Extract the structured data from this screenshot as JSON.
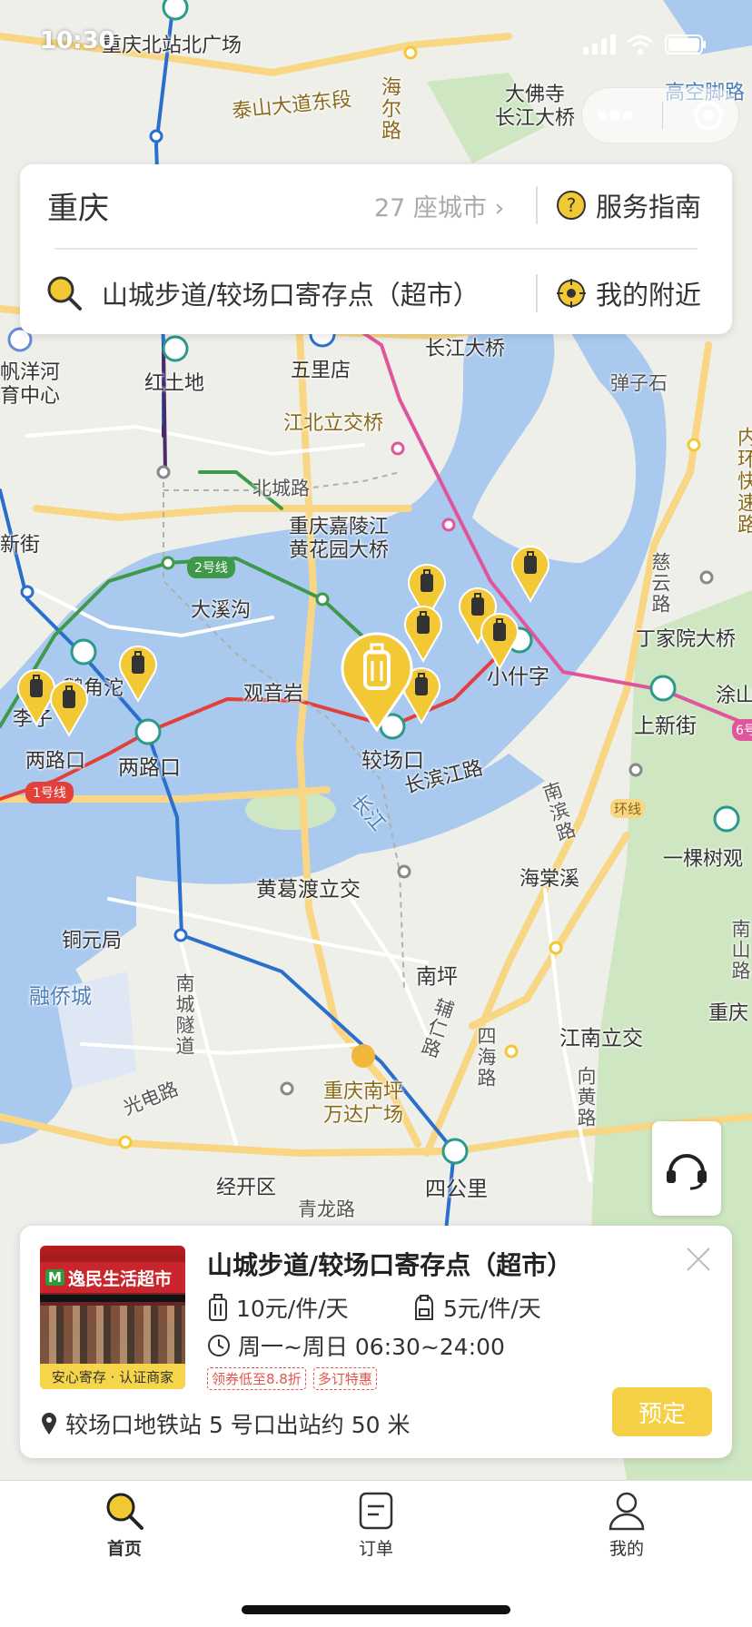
{
  "status_bar": {
    "time": "10:30"
  },
  "search": {
    "city": "重庆",
    "city_count": "27 座城市",
    "guide_label": "服务指南",
    "query": "山城步道/较场口寄存点（超市）",
    "nearby_label": "我的附近"
  },
  "map": {
    "labels": {
      "chongqing_north_square": "重庆北站北广场",
      "taishan_road": "泰山大道东段",
      "dafosi_bridge": "大佛寺\n长江大桥",
      "gaokong": "高空脚路",
      "hailu": "海尔路",
      "hongtudi": "红土地",
      "wulidian": "五里店",
      "changjiang_bridge": "长江大桥",
      "danzishi": "弹子石",
      "jiangbei_interchange": "江北立交桥",
      "fanyanghe": "帆洋河\n育中心",
      "beicheng_road": "北城路",
      "jialing_bridge": "重庆嘉陵江\n黄花园大桥",
      "daxigou": "大溪沟",
      "guanyinyan": "观音岩",
      "jiaochangkou": "较场口",
      "xiaoshizi": "小什字",
      "shangxinjie": "上新街",
      "dingjiayuan_bridge": "丁家院大桥",
      "cilu": "慈云路",
      "neihuan_exp": "内环快速路",
      "liangrukou_1": "两路口",
      "liangrukou_2": "两路口",
      "changbin_road": "长滨江路",
      "yangtze": "长江",
      "nanbin_road": "南滨路",
      "huangge_interchange": "黄葛渡立交",
      "haitangxi": "海棠溪",
      "yikeshu": "一棵树观",
      "tongyuanju": "铜元局",
      "rongqiao": "融侨城",
      "nanping": "南坪",
      "nancheng_tunnel": "南城隧道",
      "fuer_road": "辅仁路",
      "sihai_road": "四海路",
      "jiangnan_interchange": "江南立交",
      "xianghuang_road": "向黄路",
      "guangdian_road": "光电路",
      "wanda": "重庆南坪\n万达广场",
      "jingkaiqu": "经开区",
      "qinglong_road": "青龙路",
      "sigongli": "四公里",
      "huanxian": "环线",
      "chongqing_right": "重庆",
      "nanshan": "南山路",
      "tuhu": "涂山",
      "xinjie": "新街",
      "lizi": "李子",
      "ejiao": "鹅角沱"
    },
    "metro_lines": {
      "line2": {
        "label": "2号线",
        "color": "#3e9a4a"
      },
      "line1": {
        "label": "1号线",
        "color": "#e2403a"
      },
      "line6": {
        "label": "6号",
        "color": "#e0559b"
      }
    },
    "accent_color": "#f2c935"
  },
  "store": {
    "title": "山城步道/较场口寄存点（超市）",
    "photo_badge": "安心寄存 · 认证商家",
    "photo_sign": "逸民生活超市",
    "price_large": "10元/件/天",
    "price_small": "5元/件/天",
    "hours": "周一~周日 06:30~24:00",
    "tags": [
      "领券低至8.8折",
      "多订特惠"
    ],
    "address": "较场口地铁站 5 号口出站约 50 米",
    "book_label": "预定"
  },
  "tabbar": {
    "tabs": [
      {
        "label": "首页",
        "icon": "search-icon",
        "active": true
      },
      {
        "label": "订单",
        "icon": "order-icon",
        "active": false
      },
      {
        "label": "我的",
        "icon": "profile-icon",
        "active": false
      }
    ]
  }
}
